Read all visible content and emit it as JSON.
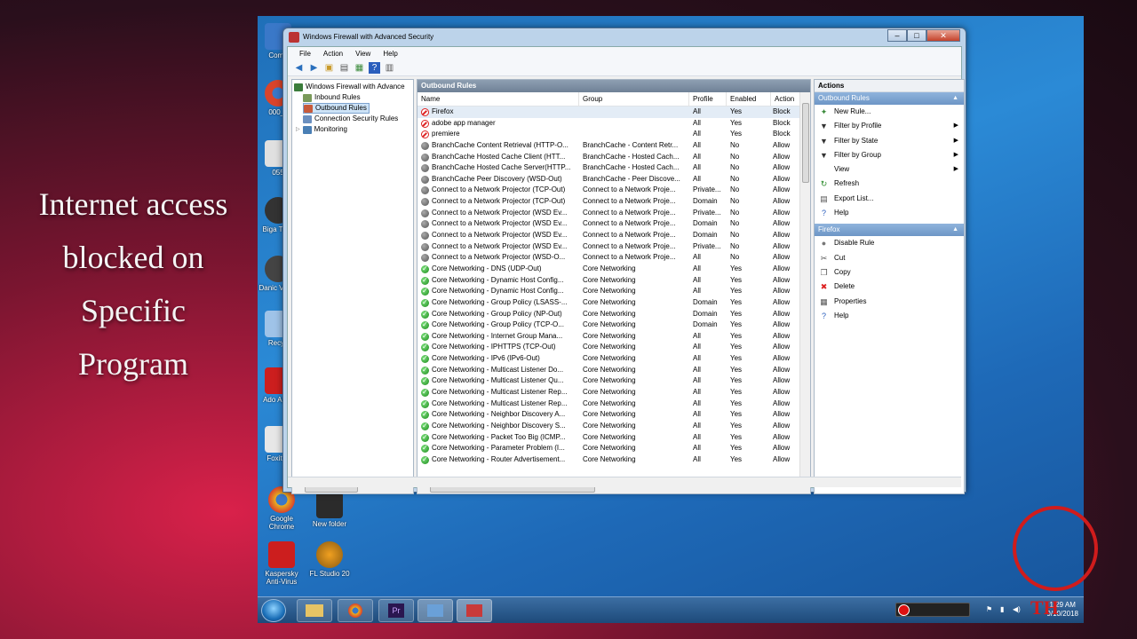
{
  "caption": [
    "Internet access",
    "blocked on",
    "Specific",
    "Program"
  ],
  "window": {
    "title": "Windows Firewall with Advanced Security",
    "menu": [
      "File",
      "Action",
      "View",
      "Help"
    ]
  },
  "tree": {
    "root": "Windows Firewall with Advance",
    "items": [
      "Inbound Rules",
      "Outbound Rules",
      "Connection Security Rules",
      "Monitoring"
    ],
    "selected": "Outbound Rules"
  },
  "rules_pane": {
    "title": "Outbound Rules",
    "columns": [
      "Name",
      "Group",
      "Profile",
      "Enabled",
      "Action"
    ],
    "rows": [
      {
        "icon": "block",
        "name": "Firefox",
        "group": "",
        "profile": "All",
        "enabled": "Yes",
        "action": "Block"
      },
      {
        "icon": "block",
        "name": "adobe app manager",
        "group": "",
        "profile": "All",
        "enabled": "Yes",
        "action": "Block"
      },
      {
        "icon": "block",
        "name": "premiere",
        "group": "",
        "profile": "All",
        "enabled": "Yes",
        "action": "Block"
      },
      {
        "icon": "gray",
        "name": "BranchCache Content Retrieval (HTTP-O...",
        "group": "BranchCache - Content Retr...",
        "profile": "All",
        "enabled": "No",
        "action": "Allow"
      },
      {
        "icon": "gray",
        "name": "BranchCache Hosted Cache Client (HTT...",
        "group": "BranchCache - Hosted Cach...",
        "profile": "All",
        "enabled": "No",
        "action": "Allow"
      },
      {
        "icon": "gray",
        "name": "BranchCache Hosted Cache Server(HTTP...",
        "group": "BranchCache - Hosted Cach...",
        "profile": "All",
        "enabled": "No",
        "action": "Allow"
      },
      {
        "icon": "gray",
        "name": "BranchCache Peer Discovery (WSD-Out)",
        "group": "BranchCache - Peer Discove...",
        "profile": "All",
        "enabled": "No",
        "action": "Allow"
      },
      {
        "icon": "gray",
        "name": "Connect to a Network Projector (TCP-Out)",
        "group": "Connect to a Network Proje...",
        "profile": "Private...",
        "enabled": "No",
        "action": "Allow"
      },
      {
        "icon": "gray",
        "name": "Connect to a Network Projector (TCP-Out)",
        "group": "Connect to a Network Proje...",
        "profile": "Domain",
        "enabled": "No",
        "action": "Allow"
      },
      {
        "icon": "gray",
        "name": "Connect to a Network Projector (WSD Ev...",
        "group": "Connect to a Network Proje...",
        "profile": "Private...",
        "enabled": "No",
        "action": "Allow"
      },
      {
        "icon": "gray",
        "name": "Connect to a Network Projector (WSD Ev...",
        "group": "Connect to a Network Proje...",
        "profile": "Domain",
        "enabled": "No",
        "action": "Allow"
      },
      {
        "icon": "gray",
        "name": "Connect to a Network Projector (WSD Ev...",
        "group": "Connect to a Network Proje...",
        "profile": "Domain",
        "enabled": "No",
        "action": "Allow"
      },
      {
        "icon": "gray",
        "name": "Connect to a Network Projector (WSD Ev...",
        "group": "Connect to a Network Proje...",
        "profile": "Private...",
        "enabled": "No",
        "action": "Allow"
      },
      {
        "icon": "gray",
        "name": "Connect to a Network Projector (WSD-O...",
        "group": "Connect to a Network Proje...",
        "profile": "All",
        "enabled": "No",
        "action": "Allow"
      },
      {
        "icon": "green",
        "name": "Core Networking - DNS (UDP-Out)",
        "group": "Core Networking",
        "profile": "All",
        "enabled": "Yes",
        "action": "Allow"
      },
      {
        "icon": "green",
        "name": "Core Networking - Dynamic Host Config...",
        "group": "Core Networking",
        "profile": "All",
        "enabled": "Yes",
        "action": "Allow"
      },
      {
        "icon": "green",
        "name": "Core Networking - Dynamic Host Config...",
        "group": "Core Networking",
        "profile": "All",
        "enabled": "Yes",
        "action": "Allow"
      },
      {
        "icon": "green",
        "name": "Core Networking - Group Policy (LSASS-...",
        "group": "Core Networking",
        "profile": "Domain",
        "enabled": "Yes",
        "action": "Allow"
      },
      {
        "icon": "green",
        "name": "Core Networking - Group Policy (NP-Out)",
        "group": "Core Networking",
        "profile": "Domain",
        "enabled": "Yes",
        "action": "Allow"
      },
      {
        "icon": "green",
        "name": "Core Networking - Group Policy (TCP-O...",
        "group": "Core Networking",
        "profile": "Domain",
        "enabled": "Yes",
        "action": "Allow"
      },
      {
        "icon": "green",
        "name": "Core Networking - Internet Group Mana...",
        "group": "Core Networking",
        "profile": "All",
        "enabled": "Yes",
        "action": "Allow"
      },
      {
        "icon": "green",
        "name": "Core Networking - IPHTTPS (TCP-Out)",
        "group": "Core Networking",
        "profile": "All",
        "enabled": "Yes",
        "action": "Allow"
      },
      {
        "icon": "green",
        "name": "Core Networking - IPv6 (IPv6-Out)",
        "group": "Core Networking",
        "profile": "All",
        "enabled": "Yes",
        "action": "Allow"
      },
      {
        "icon": "green",
        "name": "Core Networking - Multicast Listener Do...",
        "group": "Core Networking",
        "profile": "All",
        "enabled": "Yes",
        "action": "Allow"
      },
      {
        "icon": "green",
        "name": "Core Networking - Multicast Listener Qu...",
        "group": "Core Networking",
        "profile": "All",
        "enabled": "Yes",
        "action": "Allow"
      },
      {
        "icon": "green",
        "name": "Core Networking - Multicast Listener Rep...",
        "group": "Core Networking",
        "profile": "All",
        "enabled": "Yes",
        "action": "Allow"
      },
      {
        "icon": "green",
        "name": "Core Networking - Multicast Listener Rep...",
        "group": "Core Networking",
        "profile": "All",
        "enabled": "Yes",
        "action": "Allow"
      },
      {
        "icon": "green",
        "name": "Core Networking - Neighbor Discovery A...",
        "group": "Core Networking",
        "profile": "All",
        "enabled": "Yes",
        "action": "Allow"
      },
      {
        "icon": "green",
        "name": "Core Networking - Neighbor Discovery S...",
        "group": "Core Networking",
        "profile": "All",
        "enabled": "Yes",
        "action": "Allow"
      },
      {
        "icon": "green",
        "name": "Core Networking - Packet Too Big (ICMP...",
        "group": "Core Networking",
        "profile": "All",
        "enabled": "Yes",
        "action": "Allow"
      },
      {
        "icon": "green",
        "name": "Core Networking - Parameter Problem (I...",
        "group": "Core Networking",
        "profile": "All",
        "enabled": "Yes",
        "action": "Allow"
      },
      {
        "icon": "green",
        "name": "Core Networking - Router Advertisement...",
        "group": "Core Networking",
        "profile": "All",
        "enabled": "Yes",
        "action": "Allow"
      }
    ]
  },
  "actions_pane": {
    "title": "Actions",
    "section1": "Outbound Rules",
    "section1_items": [
      {
        "label": "New Rule...",
        "icon": "new-rule-icon",
        "submenu": false
      },
      {
        "label": "Filter by Profile",
        "icon": "filter-icon",
        "submenu": true
      },
      {
        "label": "Filter by State",
        "icon": "filter-icon",
        "submenu": true
      },
      {
        "label": "Filter by Group",
        "icon": "filter-icon",
        "submenu": true
      },
      {
        "label": "View",
        "icon": "",
        "submenu": true
      },
      {
        "label": "Refresh",
        "icon": "refresh-icon",
        "submenu": false
      },
      {
        "label": "Export List...",
        "icon": "export-icon",
        "submenu": false
      },
      {
        "label": "Help",
        "icon": "help-icon",
        "submenu": false
      }
    ],
    "section2": "Firefox",
    "section2_items": [
      {
        "label": "Disable Rule",
        "icon": "disable-icon"
      },
      {
        "label": "Cut",
        "icon": "cut-icon"
      },
      {
        "label": "Copy",
        "icon": "copy-icon"
      },
      {
        "label": "Delete",
        "icon": "delete-icon"
      },
      {
        "label": "Properties",
        "icon": "properties-icon"
      },
      {
        "label": "Help",
        "icon": "help-icon"
      }
    ]
  },
  "desktop_icons": [
    {
      "label": "Comp",
      "color": "#3a78c8"
    },
    {
      "label": "000_li",
      "color": "#d9442b"
    },
    {
      "label": "055",
      "color": "#e0e0e0"
    },
    {
      "label": "Biga\nTotal",
      "color": "#333333"
    },
    {
      "label": "Danic\nVideo",
      "color": "#444444"
    },
    {
      "label": "Recyc",
      "color": "#9fc3e8"
    },
    {
      "label": "Ado\nAppli",
      "color": "#cc1e1e"
    },
    {
      "label": "Foxit R",
      "color": "#e7e7e7"
    },
    {
      "label": "Google\nChrome",
      "color": "#e8b020"
    },
    {
      "label": "New folder",
      "color": "#2b2b2b"
    },
    {
      "label": "Kaspersky\nAnti-Virus",
      "color": "#cc1e1e"
    },
    {
      "label": "FL Studio 20",
      "color": "#f0a020"
    }
  ],
  "taskbar": {
    "clock_time": "1:29 AM",
    "clock_date": "9/10/2018"
  },
  "logo_text": "TH"
}
